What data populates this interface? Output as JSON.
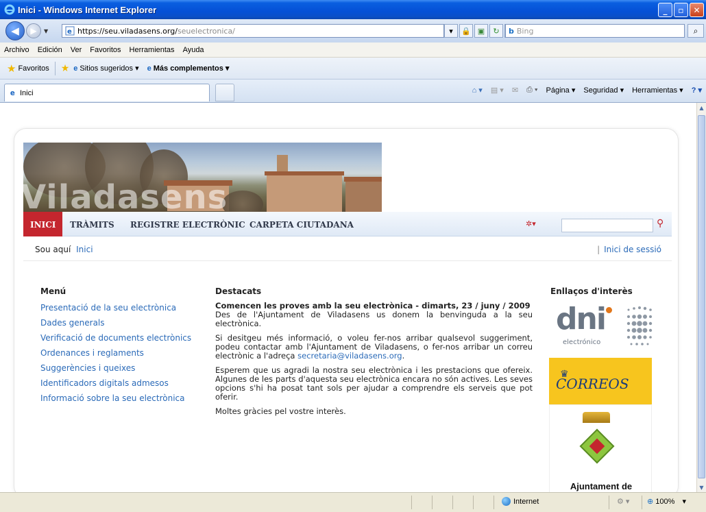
{
  "browser": {
    "window_title": "Inici - Windows Internet Explorer",
    "url_host": "https://seu.viladasens.org/",
    "url_path": "seuelectronica/",
    "search_placeholder": "Bing",
    "menu": [
      "Archivo",
      "Edición",
      "Ver",
      "Favoritos",
      "Herramientas",
      "Ayuda"
    ],
    "favorites_label": "Favoritos",
    "favorites_links": [
      "Sitios sugeridos ▾",
      "Más complementos ▾"
    ],
    "tab_title": "Inici",
    "commands": [
      "Página ▾",
      "Seguridad ▾",
      "Herramientas ▾"
    ],
    "status_zone": "Internet",
    "zoom": "100%"
  },
  "site": {
    "banner_wordmark": "Viladasens",
    "nav": [
      {
        "label": "INICI",
        "active": true
      },
      {
        "label": "TRÀMITS",
        "active": false
      },
      {
        "label": "REGISTRE ELECTRÒNIC",
        "active": false
      },
      {
        "label": "CARPETA CIUTADANA",
        "active": false
      }
    ],
    "breadcrumb_label": "Sou aquí",
    "breadcrumb_link": "Inici",
    "login": "Inici de sessió",
    "menu_title": "Menú",
    "menu_items": [
      "Presentació de la seu electrònica",
      "Dades generals",
      "Verificació de documents electrònics",
      "Ordenances i reglaments",
      "Suggerències i queixes",
      "Identificadors digitals admesos",
      "Informació sobre la seu electrònica"
    ],
    "featured_title": "Destacats",
    "featured_headline": "Comencen les proves amb la seu electrònica - dimarts, 23 / juny / 2009",
    "featured_p1": "Des de l'Ajuntament de Viladasens us donem la benvinguda a la seu electrònica.",
    "featured_p2_text": "Si desitgeu més informació, o voleu fer-nos arribar qualsevol suggeriment, podeu contactar amb l'Ajuntament de Viladasens, o fer-nos arribar un correu electrònic a l'adreça ",
    "featured_p2_email": "secretaria@viladasens.org",
    "featured_p2_end": ".",
    "featured_p3": "Esperem que us agradi la nostra seu electrònica i les prestacions que ofereix. Algunes de les parts d'aquesta seu electrònica encara no són actives. Les seves opcions s'hi ha posat tant sols per ajudar a comprendre els serveis que pot oferir.",
    "featured_p4": "Moltes gràcies pel vostre interès.",
    "links_title": "Enllaços d'interès",
    "dni_word": "dni",
    "dni_sub": "electrónico",
    "correos_word": "CORREOS",
    "ajuntament_name": "Ajuntament de Viladasens"
  },
  "colors": {
    "accent_red": "#c4262e",
    "link_blue": "#2a6ab8",
    "correos_yellow": "#f7c51e"
  }
}
